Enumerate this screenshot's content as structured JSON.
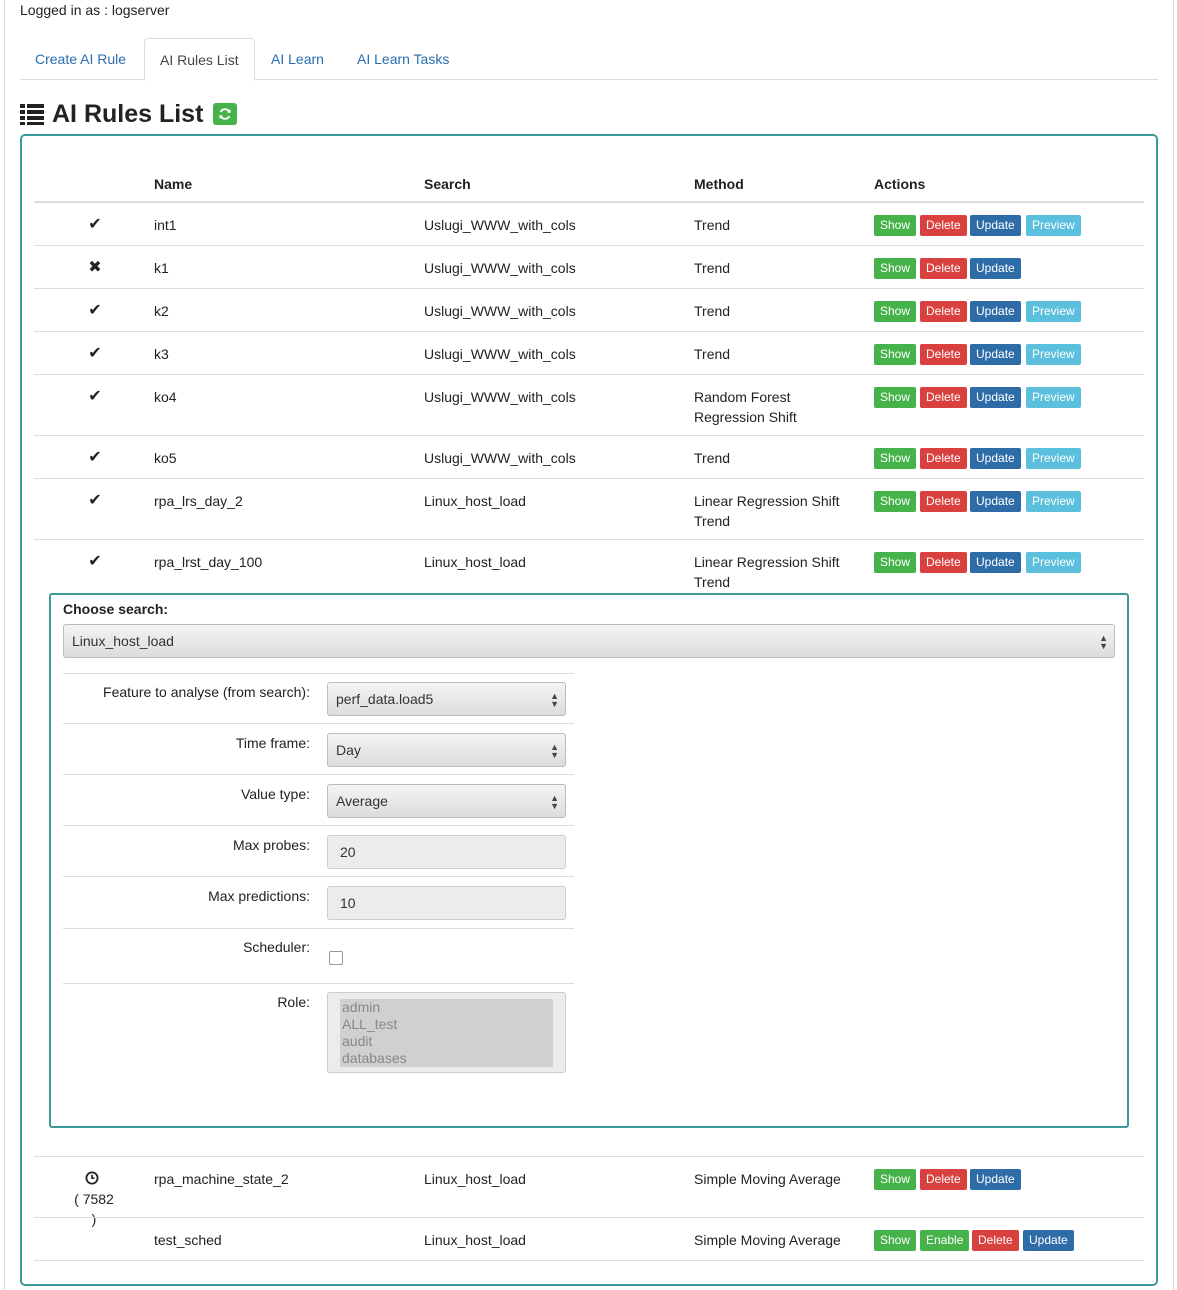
{
  "header": {
    "login_text": "Logged in as : logserver"
  },
  "tabs": [
    {
      "label": "Create AI Rule"
    },
    {
      "label": "AI Rules List"
    },
    {
      "label": "AI Learn"
    },
    {
      "label": "AI Learn Tasks"
    }
  ],
  "page": {
    "title": "AI Rules List",
    "title_icon": "list-icon",
    "refresh_icon": "refresh-icon"
  },
  "table": {
    "columns": [
      "Name",
      "Search",
      "Method",
      "Actions"
    ],
    "rows": [
      {
        "status": "✔",
        "name": "int1",
        "search": "Uslugi_WWW_with_cols",
        "method": "Trend",
        "actions": [
          "Show",
          "Delete",
          "Update",
          "Preview"
        ]
      },
      {
        "status": "✖",
        "name": "k1",
        "search": "Uslugi_WWW_with_cols",
        "method": "Trend",
        "actions": [
          "Show",
          "Delete",
          "Update"
        ]
      },
      {
        "status": "✔",
        "name": "k2",
        "search": "Uslugi_WWW_with_cols",
        "method": "Trend",
        "actions": [
          "Show",
          "Delete",
          "Update",
          "Preview"
        ]
      },
      {
        "status": "✔",
        "name": "k3",
        "search": "Uslugi_WWW_with_cols",
        "method": "Trend",
        "actions": [
          "Show",
          "Delete",
          "Update",
          "Preview"
        ]
      },
      {
        "status": "✔",
        "name": "ko4",
        "search": "Uslugi_WWW_with_cols",
        "method_line1": "Random Forest",
        "method_line2": "Regression Shift",
        "actions": [
          "Show",
          "Delete",
          "Update",
          "Preview"
        ]
      },
      {
        "status": "✔",
        "name": "ko5",
        "search": "Uslugi_WWW_with_cols",
        "method": "Trend",
        "actions": [
          "Show",
          "Delete",
          "Update",
          "Preview"
        ]
      },
      {
        "status": "✔",
        "name": "rpa_lrs_day_2",
        "search": "Linux_host_load",
        "method_line1": "Linear Regression Shift",
        "method_line2": "Trend",
        "actions": [
          "Show",
          "Delete",
          "Update",
          "Preview"
        ]
      },
      {
        "status": "✔",
        "name": "rpa_lrst_day_100",
        "search": "Linux_host_load",
        "method_line1": "Linear Regression Shift",
        "method_line2": "Trend",
        "actions": [
          "Show",
          "Delete",
          "Update",
          "Preview"
        ]
      },
      {
        "status_icon": "clock-icon",
        "status_count": "( 7582 )",
        "name": "rpa_machine_state_2",
        "search": "Linux_host_load",
        "method": "Simple Moving Average",
        "actions": [
          "Show",
          "Delete",
          "Update"
        ]
      },
      {
        "name": "test_sched",
        "search": "Linux_host_load",
        "method": "Simple Moving Average",
        "actions": [
          "Show",
          "Enable",
          "Delete",
          "Update"
        ]
      }
    ]
  },
  "editor": {
    "choose_search_label": "Choose search:",
    "choose_search_value": "Linux_host_load",
    "feature_label": "Feature to analyse (from search):",
    "feature_value": "perf_data.load5",
    "timeframe_label": "Time frame:",
    "timeframe_value": "Day",
    "valuetype_label": "Value type:",
    "valuetype_value": "Average",
    "maxprobes_label": "Max probes:",
    "maxprobes_value": "20",
    "maxpred_label": "Max predictions:",
    "maxpred_value": "10",
    "scheduler_label": "Scheduler:",
    "scheduler_checked": false,
    "role_label": "Role:",
    "role_options": [
      "admin",
      "ALL_test",
      "audit",
      "databases"
    ]
  },
  "colors": {
    "accent": "#3b9b98",
    "show": "#45b24a",
    "delete": "#d9413f",
    "update": "#2e6ca8",
    "preview": "#5bc0de",
    "link": "#2a6db0"
  }
}
